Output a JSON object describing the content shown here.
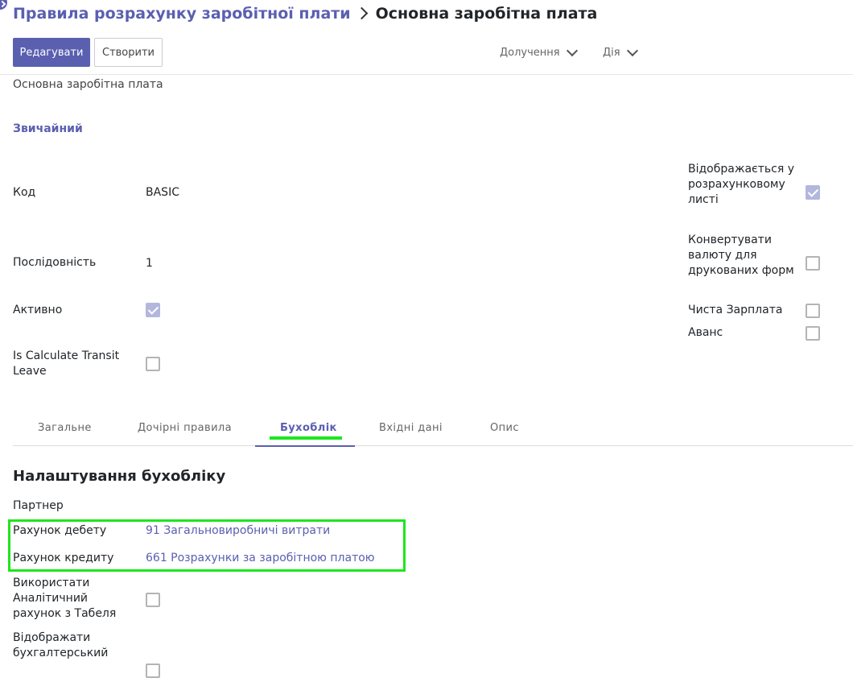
{
  "breadcrumb": {
    "parent": "Правила розрахунку заробітної плати",
    "current": "Основна заробітна плата"
  },
  "buttons": {
    "edit": "Редагувати",
    "create": "Створити"
  },
  "dropdowns": {
    "attachments": "Долучення",
    "action": "Дія"
  },
  "record": {
    "name": "Основна заробітна плата",
    "category": "Звичайний"
  },
  "fields": {
    "code_label": "Код",
    "code_value": "BASIC",
    "sequence_label": "Послідовність",
    "sequence_value": "1",
    "active_label": "Активно",
    "active_checked": true,
    "transit_label": "Is Calculate Transit Leave",
    "transit_checked": false,
    "appears_label": "Відображається у розрахунковому листі",
    "appears_checked": true,
    "convert_label": "Конвертувати валюту для друкованих форм",
    "convert_checked": false,
    "net_label": "Чиста Зарплата",
    "net_checked": false,
    "advance_label": "Аванс",
    "advance_checked": false
  },
  "tabs": [
    {
      "label": "Загальне",
      "active": false
    },
    {
      "label": "Дочірні правила",
      "active": false
    },
    {
      "label": "Бухоблік",
      "active": true
    },
    {
      "label": "Вхідні дані",
      "active": false
    },
    {
      "label": "Опис",
      "active": false
    }
  ],
  "accounting": {
    "title": "Налаштування бухобліку",
    "partner_label": "Партнер",
    "debit_label": "Рахунок дебету",
    "debit_value": "91 Загальновиробничі витрати",
    "credit_label": "Рахунок кредиту",
    "credit_value": "661 Розрахунки за заробітною платою",
    "analytic_label": "Використати Аналітичний рахунок з Табеля",
    "analytic_checked": false,
    "display_label": "Відображати бухгалтерський"
  },
  "colors": {
    "accent": "#5a5fb0",
    "highlight": "#1ee61e"
  }
}
